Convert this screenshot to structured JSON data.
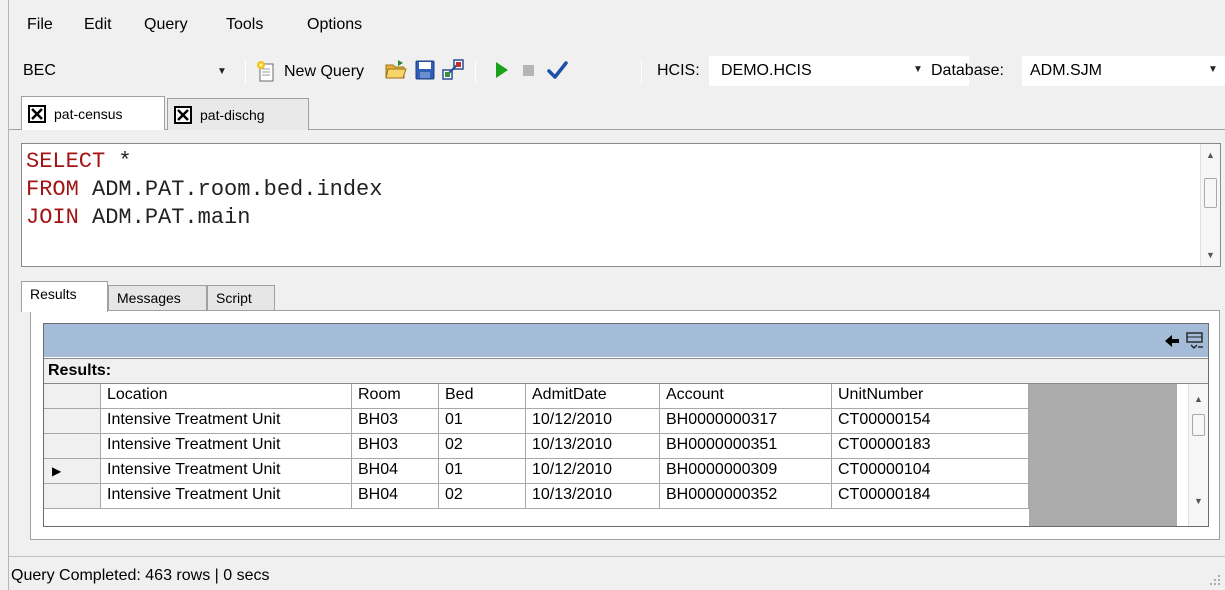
{
  "menu": [
    "File",
    "Edit",
    "Query",
    "Tools",
    "Options"
  ],
  "toolbar": {
    "connection_value": "BEC",
    "new_query_label": "New Query",
    "hcis_label": "HCIS:",
    "hcis_value": "DEMO.HCIS",
    "database_label": "Database:",
    "database_value": "ADM.SJM"
  },
  "doc_tabs": [
    {
      "label": "pat-census",
      "active": true
    },
    {
      "label": "pat-dischg",
      "active": false
    }
  ],
  "editor": {
    "lines": [
      {
        "keyword": "SELECT",
        "text": " *"
      },
      {
        "keyword": "FROM",
        "text": " ADM.PAT.room.bed.index"
      },
      {
        "keyword": "JOIN",
        "text": " ADM.PAT.main"
      }
    ]
  },
  "result_tabs": [
    "Results",
    "Messages",
    "Script"
  ],
  "results": {
    "title": "Results:",
    "columns": [
      "Location",
      "Room",
      "Bed",
      "AdmitDate",
      "Account",
      "UnitNumber"
    ],
    "rows": [
      [
        "Intensive Treatment Unit",
        "BH03",
        "01",
        "10/12/2010",
        "BH0000000317",
        "CT00000154"
      ],
      [
        "Intensive Treatment Unit",
        "BH03",
        "02",
        "10/13/2010",
        "BH0000000351",
        "CT00000183"
      ],
      [
        "Intensive Treatment Unit",
        "BH04",
        "01",
        "10/12/2010",
        "BH0000000309",
        "CT00000104"
      ],
      [
        "Intensive Treatment Unit",
        "BH04",
        "02",
        "10/13/2010",
        "BH0000000352",
        "CT00000184"
      ]
    ],
    "current_row_marker": "▶"
  },
  "status": {
    "text": "Query Completed: 463 rows | 0 secs"
  },
  "colors": {
    "keyword": "#a31515",
    "grid_header": "#a4bcd8",
    "run_green": "#1aa31a",
    "check_blue": "#1f4ea8"
  }
}
